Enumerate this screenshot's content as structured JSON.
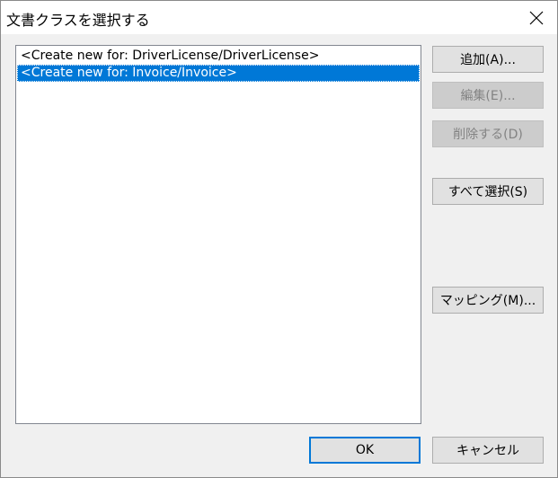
{
  "window": {
    "title": "文書クラスを選択する"
  },
  "list": {
    "items": [
      {
        "label": "<Create new for: DriverLicense/DriverLicense>",
        "selected": false
      },
      {
        "label": "<Create new for: Invoice/Invoice>",
        "selected": true
      }
    ]
  },
  "buttons": {
    "add": "追加(A)...",
    "edit": "編集(E)...",
    "delete": "削除する(D)",
    "select_all": "すべて選択(S)",
    "mapping": "マッピング(M)...",
    "ok": "OK",
    "cancel": "キャンセル"
  },
  "colors": {
    "selection": "#0078d7",
    "dialog_bg": "#f0f0f0",
    "button_bg": "#e1e1e1",
    "disabled_text": "#838383"
  },
  "icons": {
    "close": "close-icon"
  }
}
